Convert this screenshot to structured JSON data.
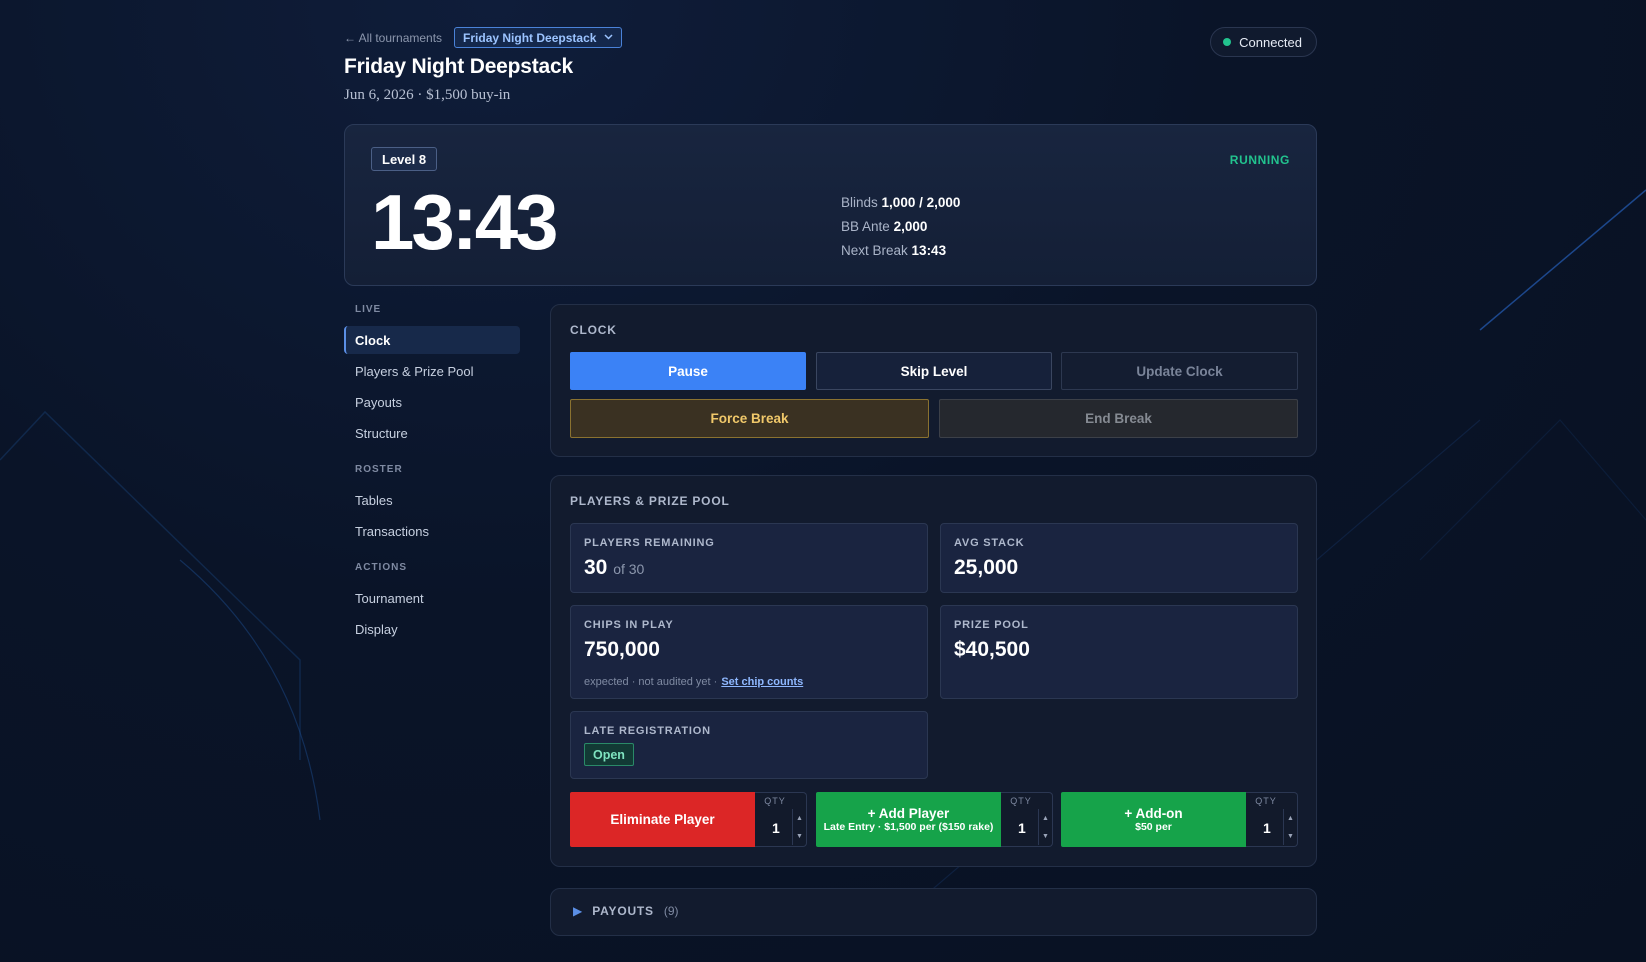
{
  "header": {
    "back_link": "← All tournaments",
    "tournament_select": "Friday Night Deepstack",
    "connection": "Connected",
    "title": "Friday Night Deepstack",
    "subtitle": "Jun 6, 2026 · $1,500 buy-in"
  },
  "clock_card": {
    "level": "Level 8",
    "status": "RUNNING",
    "time": "13:43",
    "blinds_label": "Blinds",
    "blinds_value": "1,000 / 2,000",
    "ante_label": "BB Ante",
    "ante_value": "2,000",
    "next_break_label": "Next Break",
    "next_break_value": "13:43"
  },
  "sidebar": {
    "sections": [
      {
        "title": "LIVE",
        "items": [
          "Clock",
          "Players & Prize Pool",
          "Payouts",
          "Structure"
        ]
      },
      {
        "title": "ROSTER",
        "items": [
          "Tables",
          "Transactions"
        ]
      },
      {
        "title": "ACTIONS",
        "items": [
          "Tournament",
          "Display"
        ]
      }
    ],
    "active": "Clock"
  },
  "clock_panel": {
    "title": "CLOCK",
    "pause": "Pause",
    "skip_level": "Skip Level",
    "update_clock": "Update Clock",
    "force_break": "Force Break",
    "end_break": "End Break"
  },
  "players_panel": {
    "title": "PLAYERS & PRIZE POOL",
    "players_remaining_label": "PLAYERS REMAINING",
    "players_remaining": "30",
    "players_total": "of 30",
    "avg_stack_label": "AVG STACK",
    "avg_stack": "25,000",
    "chips_label": "CHIPS IN PLAY",
    "chips": "750,000",
    "chips_note": "expected · not audited yet ·",
    "chips_link": "Set chip counts",
    "prize_pool_label": "PRIZE POOL",
    "prize_pool": "$40,500",
    "late_reg_label": "LATE REGISTRATION",
    "late_reg_status": "Open",
    "actions": {
      "eliminate": "Eliminate Player",
      "add_player": "+ Add Player",
      "add_player_sub": "Late Entry · $1,500 per ($150 rake)",
      "addon": "+ Add-on",
      "addon_sub": "$50 per",
      "qty_label": "QTY",
      "qty_eliminate": "1",
      "qty_add_player": "1",
      "qty_addon": "1"
    }
  },
  "payouts_panel": {
    "title": "PAYOUTS",
    "count": "(9)"
  },
  "colors": {
    "accent": "#3b82f6",
    "success": "#22c38e",
    "danger": "#dc2626",
    "green_button": "#16a34a",
    "warning": "#f0c86a"
  }
}
